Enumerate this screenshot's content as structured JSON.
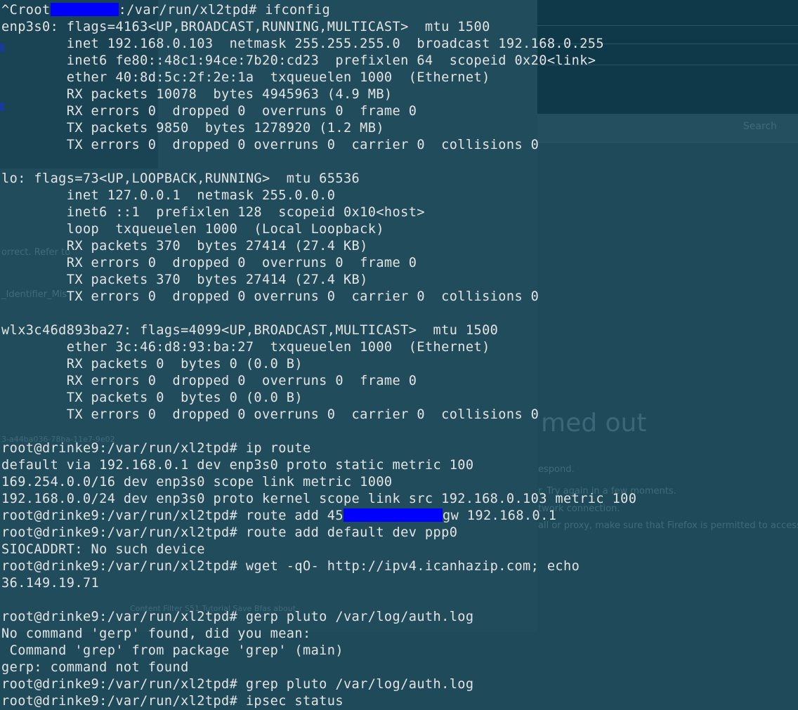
{
  "terminal": {
    "lines": [
      [
        "^Croot",
        "__REDACT1__",
        ":/var/run/xl2tpd# ifconfig"
      ],
      [
        "enp3s0: flags=4163<UP,BROADCAST,RUNNING,MULTICAST>  mtu 1500"
      ],
      [
        "        inet 192.168.0.103  netmask 255.255.255.0  broadcast 192.168.0.255"
      ],
      [
        "        inet6 fe80::48c1:94ce:7b20:cd23  prefixlen 64  scopeid 0x20<link>"
      ],
      [
        "        ether 40:8d:5c:2f:2e:1a  txqueuelen 1000  (Ethernet)"
      ],
      [
        "        RX packets 10078  bytes 4945963 (4.9 MB)"
      ],
      [
        "        RX errors 0  dropped 0  overruns 0  frame 0"
      ],
      [
        "        TX packets 9850  bytes 1278920 (1.2 MB)"
      ],
      [
        "        TX errors 0  dropped 0 overruns 0  carrier 0  collisions 0"
      ],
      [
        ""
      ],
      [
        "lo: flags=73<UP,LOOPBACK,RUNNING>  mtu 65536"
      ],
      [
        "        inet 127.0.0.1  netmask 255.0.0.0"
      ],
      [
        "        inet6 ::1  prefixlen 128  scopeid 0x10<host>"
      ],
      [
        "        loop  txqueuelen 1000  (Local Loopback)"
      ],
      [
        "        RX packets 370  bytes 27414 (27.4 KB)"
      ],
      [
        "        RX errors 0  dropped 0  overruns 0  frame 0"
      ],
      [
        "        TX packets 370  bytes 27414 (27.4 KB)"
      ],
      [
        "        TX errors 0  dropped 0 overruns 0  carrier 0  collisions 0"
      ],
      [
        ""
      ],
      [
        "wlx3c46d893ba27: flags=4099<UP,BROADCAST,MULTICAST>  mtu 1500"
      ],
      [
        "        ether 3c:46:d8:93:ba:27  txqueuelen 1000  (Ethernet)"
      ],
      [
        "        RX packets 0  bytes 0 (0.0 B)"
      ],
      [
        "        RX errors 0  dropped 0  overruns 0  frame 0"
      ],
      [
        "        TX packets 0  bytes 0 (0.0 B)"
      ],
      [
        "        TX errors 0  dropped 0 overruns 0  carrier 0  collisions 0"
      ],
      [
        ""
      ],
      [
        "root@drinke9:/var/run/xl2tpd# ip route"
      ],
      [
        "default via 192.168.0.1 dev enp3s0 proto static metric 100"
      ],
      [
        "169.254.0.0/16 dev enp3s0 scope link metric 1000"
      ],
      [
        "192.168.0.0/24 dev enp3s0 proto kernel scope link src 192.168.0.103 metric 100"
      ],
      [
        "root@drinke9:/var/run/xl2tpd# route add 45",
        "__REDACT2__",
        "gw 192.168.0.1"
      ],
      [
        "root@drinke9:/var/run/xl2tpd# route add default dev ppp0"
      ],
      [
        "SIOCADDRT: No such device"
      ],
      [
        "root@drinke9:/var/run/xl2tpd# wget -qO- http://ipv4.icanhazip.com; echo"
      ],
      [
        "36.149.19.71"
      ],
      [
        ""
      ],
      [
        "root@drinke9:/var/run/xl2tpd# gerp pluto /var/log/auth.log"
      ],
      [
        "No command 'gerp' found, did you mean:"
      ],
      [
        " Command 'grep' from package 'grep' (main)"
      ],
      [
        "gerp: command not found"
      ],
      [
        "root@drinke9:/var/run/xl2tpd# grep pluto /var/log/auth.log"
      ],
      [
        "root@drinke9:/var/run/xl2tpd# ipsec status"
      ]
    ]
  },
  "background": {
    "title": "med out",
    "line1": "espond.",
    "line2": "r. Try again in a few moments.",
    "line3": "twork connection.",
    "line4": "all or proxy, make sure that Firefox is permitted to access",
    "search": "Search",
    "side1": "orrect. Refer to",
    "side2": "_Identifier_Mis",
    "side3": "3-a44ba036-78ba-11e7-9e02",
    "footer": "Content Filter    S51    Tutorial    Save    Bfas    about"
  },
  "colors": {
    "terminal_bg": "#1f4a59",
    "text": "#e4e4e4",
    "redaction": "#0000ff"
  }
}
